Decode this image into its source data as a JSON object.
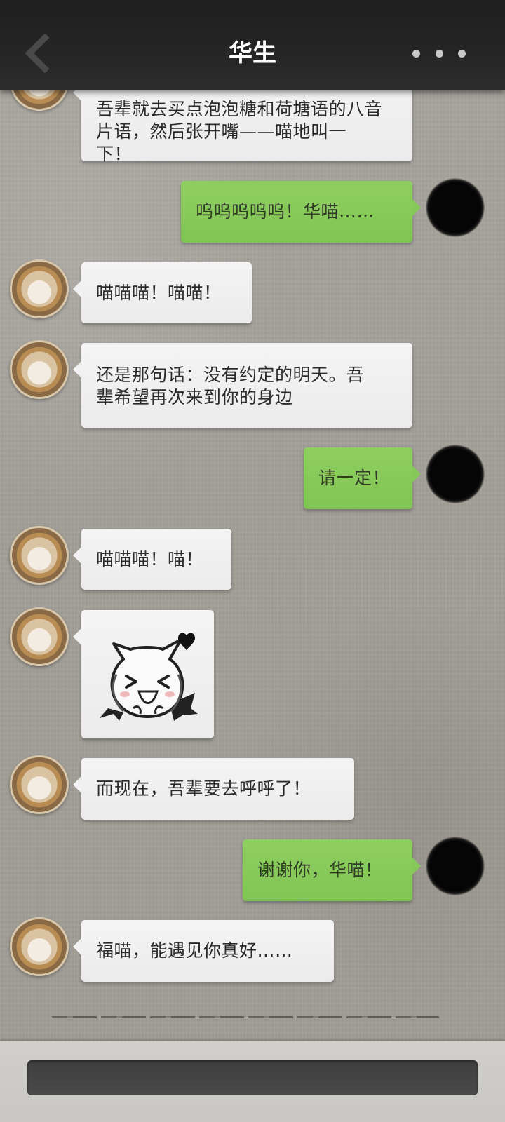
{
  "header": {
    "title": "华生",
    "back_icon": "chevron-left-icon",
    "more_icon": "more-dots-icon"
  },
  "colors": {
    "top_bar": "#262626",
    "incoming_bubble": "#efefef",
    "outgoing_bubble": "#86c95a",
    "background": "#a5a19b"
  },
  "messages": [
    {
      "from": "contact",
      "text": "吾辈就去买点泡泡糖和荷塘语的八音\n片语，然后张开嘴——喵地叫一\n下！"
    },
    {
      "from": "me",
      "text": "呜呜呜呜呜！华喵……"
    },
    {
      "from": "contact",
      "text": "喵喵喵！喵喵！"
    },
    {
      "from": "contact",
      "text": "还是那句话：没有约定的明天。吾\n辈希望再次来到你的身边"
    },
    {
      "from": "me",
      "text": "请一定！"
    },
    {
      "from": "contact",
      "text": "喵喵喵！喵！"
    },
    {
      "from": "contact",
      "type": "sticker",
      "sticker": "laughing-cat-devil-sticker"
    },
    {
      "from": "contact",
      "text": "而现在，吾辈要去呼呼了！"
    },
    {
      "from": "me",
      "text": "谢谢你，华喵！"
    },
    {
      "from": "contact",
      "text": "福喵，能遇见你真好……"
    }
  ],
  "input": {
    "value": "",
    "placeholder": ""
  }
}
